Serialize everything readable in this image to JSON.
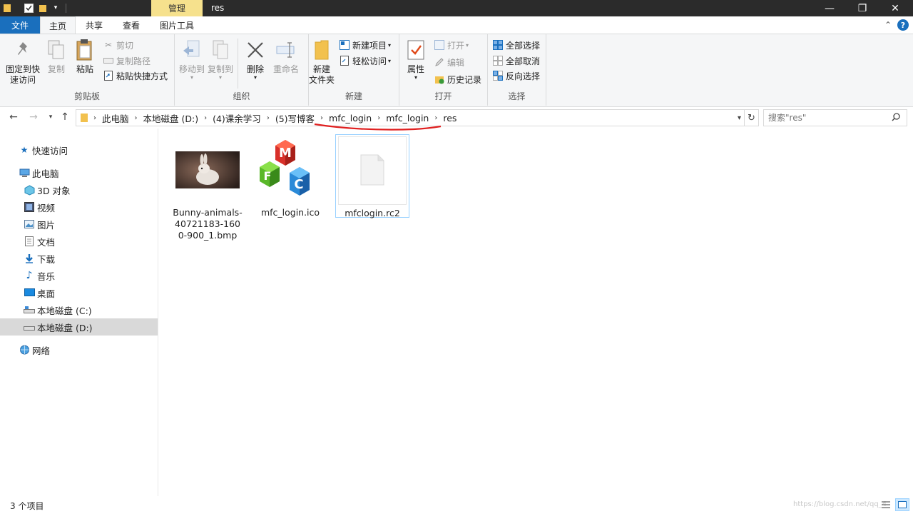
{
  "titlebar": {
    "manage_tab": "管理",
    "title": "res",
    "minimize": "—",
    "maximize": "❐",
    "close": "✕"
  },
  "tabs": {
    "file": "文件",
    "home": "主页",
    "share": "共享",
    "view": "查看",
    "tools": "图片工具"
  },
  "ribbon": {
    "clipboard": {
      "label": "剪贴板",
      "pin": "固定到快速访问",
      "pin_line1": "固定到快",
      "pin_line2": "速访问",
      "copy": "复制",
      "paste": "粘贴",
      "cut": "剪切",
      "copy_path": "复制路径",
      "paste_shortcut": "粘贴快捷方式"
    },
    "organize": {
      "label": "组织",
      "move_to": "移动到",
      "copy_to": "复制到",
      "delete": "删除",
      "rename": "重命名"
    },
    "new": {
      "label": "新建",
      "new_folder_line1": "新建",
      "new_folder_line2": "文件夹",
      "new_item": "新建项目",
      "easy_access": "轻松访问"
    },
    "open": {
      "label": "打开",
      "properties": "属性",
      "open": "打开",
      "edit": "编辑",
      "history": "历史记录"
    },
    "select": {
      "label": "选择",
      "select_all": "全部选择",
      "select_none": "全部取消",
      "invert": "反向选择"
    }
  },
  "address": {
    "crumbs": [
      "此电脑",
      "本地磁盘 (D:)",
      "(4)课余学习",
      "(5)写博客",
      "mfc_login",
      "mfc_login",
      "res"
    ],
    "search_placeholder": "搜索\"res\""
  },
  "navpane": {
    "quick_access": "快速访问",
    "this_pc": "此电脑",
    "objects3d": "3D 对象",
    "videos": "视频",
    "pictures": "图片",
    "documents": "文档",
    "downloads": "下载",
    "music": "音乐",
    "desktop": "桌面",
    "drive_c": "本地磁盘 (C:)",
    "drive_d": "本地磁盘 (D:)",
    "network": "网络"
  },
  "files": [
    {
      "name": "Bunny-animals-40721183-1600-900_1.bmp",
      "line1": "Bunny-animals-",
      "line2": "40721183-160",
      "line3": "0-900_1.bmp"
    },
    {
      "name": "mfc_login.ico",
      "mfc_letters": [
        "M",
        "F",
        "C"
      ]
    },
    {
      "name": "mfclogin.rc2"
    }
  ],
  "status": {
    "count": "3 个项目",
    "watermark": "https://blog.csdn.net/qq_4"
  },
  "colors": {
    "file_tab": "#1a6fbd",
    "manage_tab": "#f6e18d",
    "annotation": "#e02020",
    "selected_nav": "#d9d9d9"
  }
}
